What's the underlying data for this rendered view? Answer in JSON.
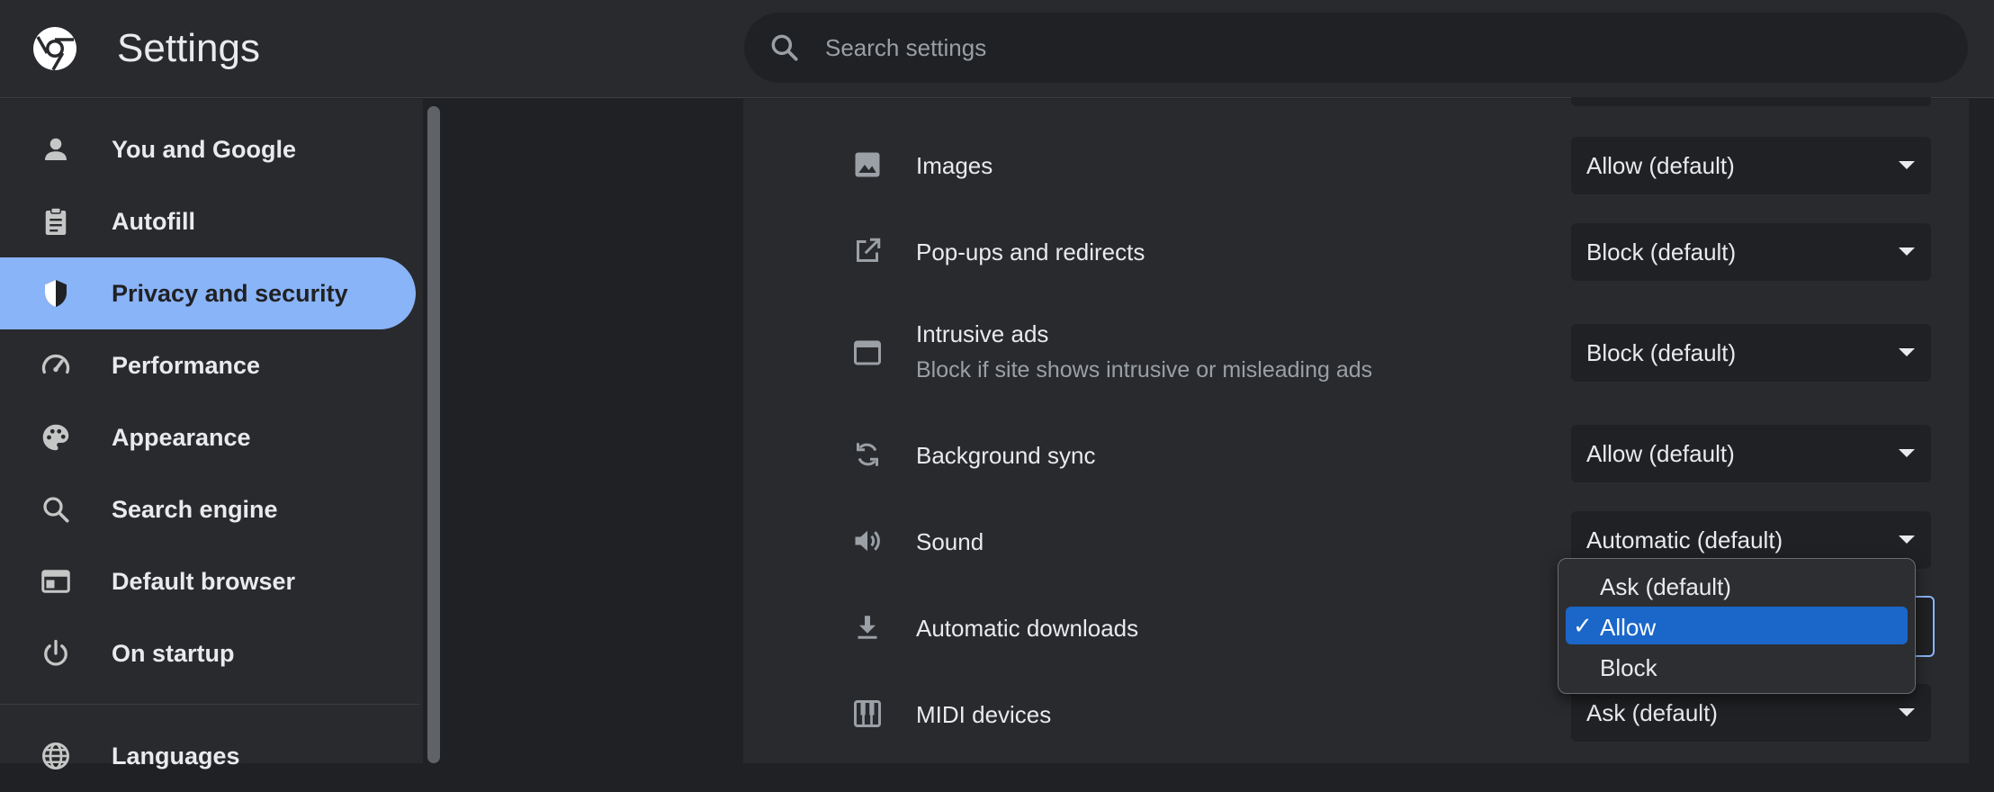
{
  "header": {
    "title": "Settings",
    "search_placeholder": "Search settings"
  },
  "sidebar": {
    "items": [
      {
        "label": "You and Google",
        "icon": "person-icon"
      },
      {
        "label": "Autofill",
        "icon": "clipboard-icon"
      },
      {
        "label": "Privacy and security",
        "icon": "shield-icon",
        "active": true
      },
      {
        "label": "Performance",
        "icon": "speedometer-icon"
      },
      {
        "label": "Appearance",
        "icon": "palette-icon"
      },
      {
        "label": "Search engine",
        "icon": "search-icon"
      },
      {
        "label": "Default browser",
        "icon": "browser-window-icon"
      },
      {
        "label": "On startup",
        "icon": "power-icon"
      },
      {
        "label": "Languages",
        "icon": "globe-icon"
      }
    ]
  },
  "permissions": [
    {
      "label": "Images",
      "value": "Allow (default)",
      "icon": "image-icon"
    },
    {
      "label": "Pop-ups and redirects",
      "value": "Block (default)",
      "icon": "open-in-new-icon"
    },
    {
      "label": "Intrusive ads",
      "sub": "Block if site shows intrusive or misleading ads",
      "value": "Block (default)",
      "icon": "window-icon"
    },
    {
      "label": "Background sync",
      "value": "Allow (default)",
      "icon": "sync-icon"
    },
    {
      "label": "Sound",
      "value": "Automatic (default)",
      "icon": "speaker-icon"
    },
    {
      "label": "Automatic downloads",
      "value": "Allow",
      "icon": "download-icon"
    },
    {
      "label": "MIDI devices",
      "value": "Ask (default)",
      "icon": "piano-icon"
    }
  ],
  "dropdown": {
    "options": [
      "Ask (default)",
      "Allow",
      "Block"
    ],
    "selected": "Allow",
    "check": "✓"
  },
  "colors": {
    "accent": "#8ab4f8",
    "selection": "#1a66c9",
    "background": "#202124",
    "surface": "#292a2d"
  }
}
